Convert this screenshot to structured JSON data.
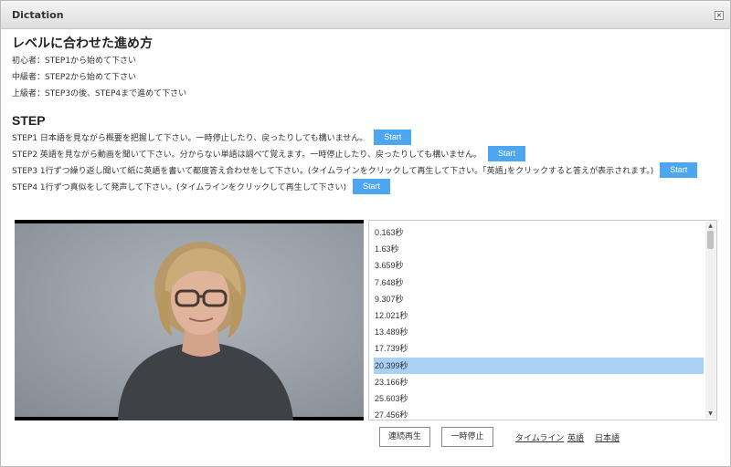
{
  "window": {
    "title": "Dictation",
    "close_label": "×"
  },
  "level": {
    "heading": "レベルに合わせた進め方",
    "items": [
      "初心者：STEP1から始めて下さい",
      "中級者：STEP2から始めて下さい",
      "上級者：STEP3の後、STEP4まで進めて下さい"
    ]
  },
  "steps": {
    "heading": "STEP",
    "items": [
      {
        "text": "STEP1 日本語を見ながら概要を把握して下さい。一時停止したり、戻ったりしても構いません。",
        "button": "Start"
      },
      {
        "text": "STEP2 英語を見ながら動画を聞いて下さい。分からない単語は調べて覚えます。一時停止したり、戻ったりしても構いません。",
        "button": "Start"
      },
      {
        "text": "STEP3 1行ずつ繰り返し聞いて紙に英語を書いて都度答え合わせをして下さい。(タイムラインをクリックして再生して下さい。｢英語｣をクリックすると答えが表示されます。)",
        "button": "Start"
      },
      {
        "text": "STEP4 1行ずつ真似をして発声して下さい。(タイムラインをクリックして再生して下さい)",
        "button": "Start"
      }
    ]
  },
  "timeline": {
    "items": [
      "0.163秒",
      "1.63秒",
      "3.659秒",
      "7.648秒",
      "9.307秒",
      "12.021秒",
      "13.489秒",
      "17.739秒",
      "20.399秒",
      "23.166秒",
      "25.603秒",
      "27.456秒"
    ],
    "selected_index": 8
  },
  "controls": {
    "continuous_play": "連続再生",
    "pause": "一時停止",
    "links": [
      "タイムライン",
      "英語",
      "日本語"
    ]
  },
  "colors": {
    "accent": "#4da6f0",
    "selected_row": "#a9d0f5"
  }
}
